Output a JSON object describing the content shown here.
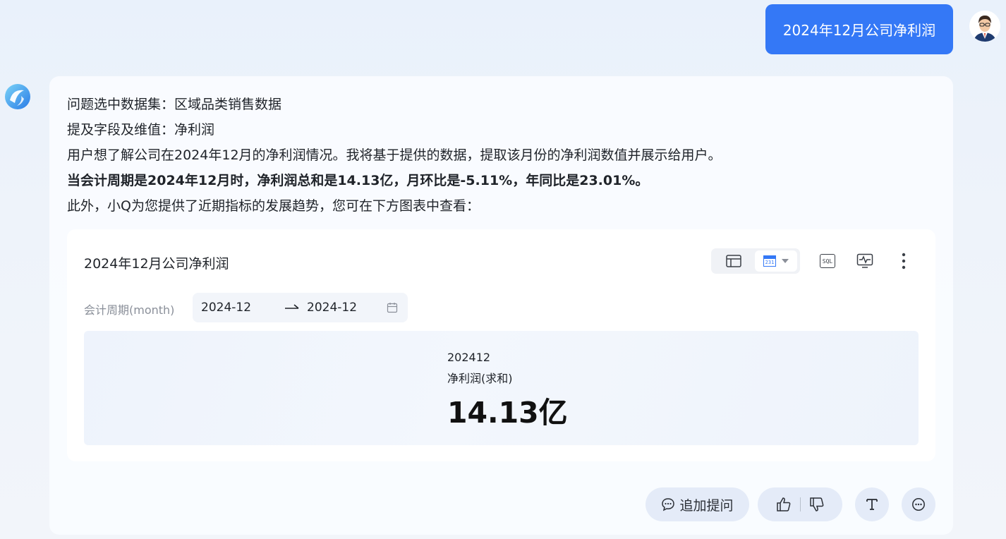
{
  "user_message": {
    "text": "2024年12月公司净利润"
  },
  "answer": {
    "lines": [
      "问题选中数据集：区域品类销售数据",
      "提及字段及维值：净利润",
      "用户想了解公司在2024年12月的净利润情况。我将基于提供的数据，提取该月份的净利润数值并展示给用户。",
      "当会计周期是2024年12月时，净利润总和是14.13亿，月环比是-5.11%，年同比是23.01%。",
      "此外，小Q为您提供了近期指标的发展趋势，您可在下方图表中查看："
    ]
  },
  "chart_card": {
    "title": "2024年12月公司净利润",
    "view_icons": [
      "table-icon",
      "kpi-icon"
    ],
    "kpi_icon_text": "231",
    "tool_icons": [
      "sql-icon",
      "monitor-icon",
      "more-vertical-icon"
    ],
    "sql_label": "SQL",
    "filter": {
      "label": "会计周期(month)",
      "start": "2024-12",
      "end": "2024-12"
    },
    "kpi": {
      "period": "202412",
      "metric": "净利润(求和)",
      "value": "14.13亿"
    }
  },
  "actions": {
    "followup_label": "追加提问"
  },
  "colors": {
    "accent": "#3478f6",
    "kpi_panel_bg": "#eef3fc",
    "action_bg": "#e4ebf8"
  }
}
